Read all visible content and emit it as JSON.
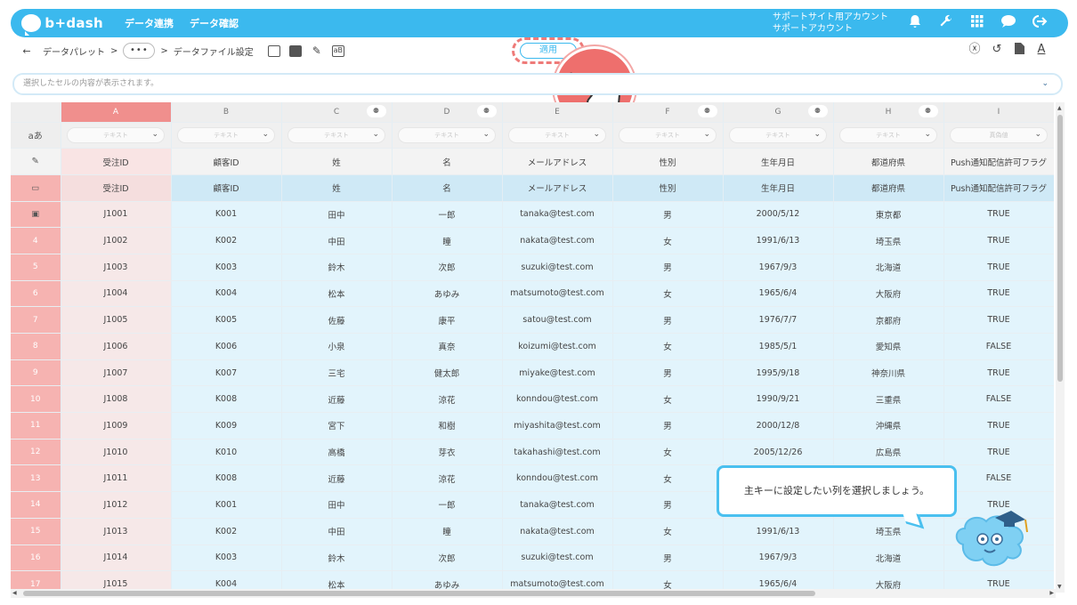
{
  "header": {
    "logo": "b+dash",
    "nav": [
      "データ連携",
      "データ確認"
    ],
    "account_line1": "サポートサイト用アカウント",
    "account_line2": "サポートアカウント",
    "icons": [
      "bell-icon",
      "wrench-icon",
      "grid-icon",
      "chat-icon",
      "logout-icon"
    ]
  },
  "toolbar": {
    "back": "←",
    "crumb1": "データパレット",
    "sep": ">",
    "ellipsis": "•••",
    "crumb2": "データファイル設定",
    "apply": "適用",
    "right_icons": [
      "clear-icon",
      "history-icon",
      "file-icon",
      "text-format-icon"
    ]
  },
  "cellbar": {
    "placeholder": "選択したセルの内容が表示されます。"
  },
  "grid": {
    "columns": [
      "A",
      "B",
      "C",
      "D",
      "E",
      "F",
      "G",
      "H",
      "I"
    ],
    "type_label": "aあ",
    "type_values": [
      "テキスト",
      "テキスト",
      "テキスト",
      "テキスト",
      "テキスト",
      "テキスト",
      "テキスト",
      "テキスト",
      "真偽値"
    ],
    "names": [
      "受注ID",
      "顧客ID",
      "姓",
      "名",
      "メールアドレス",
      "性別",
      "生年月日",
      "都道府県",
      "Push通知配信許可フラグ"
    ],
    "header_row": [
      "受注ID",
      "顧客ID",
      "姓",
      "名",
      "メールアドレス",
      "性別",
      "生年月日",
      "都道府県",
      "Push通知配信許可フラグ"
    ],
    "rows": [
      {
        "n": "",
        "cells": [
          "J1001",
          "K001",
          "田中",
          "一郎",
          "tanaka@test.com",
          "男",
          "2000/5/12",
          "東京都",
          "TRUE"
        ]
      },
      {
        "n": "4",
        "cells": [
          "J1002",
          "K002",
          "中田",
          "瞳",
          "nakata@test.com",
          "女",
          "1991/6/13",
          "埼玉県",
          "TRUE"
        ]
      },
      {
        "n": "5",
        "cells": [
          "J1003",
          "K003",
          "鈴木",
          "次郎",
          "suzuki@test.com",
          "男",
          "1967/9/3",
          "北海道",
          "TRUE"
        ]
      },
      {
        "n": "6",
        "cells": [
          "J1004",
          "K004",
          "松本",
          "あゆみ",
          "matsumoto@test.com",
          "女",
          "1965/6/4",
          "大阪府",
          "TRUE"
        ]
      },
      {
        "n": "7",
        "cells": [
          "J1005",
          "K005",
          "佐藤",
          "康平",
          "satou@test.com",
          "男",
          "1976/7/7",
          "京都府",
          "TRUE"
        ]
      },
      {
        "n": "8",
        "cells": [
          "J1006",
          "K006",
          "小泉",
          "真奈",
          "koizumi@test.com",
          "女",
          "1985/5/1",
          "愛知県",
          "FALSE"
        ]
      },
      {
        "n": "9",
        "cells": [
          "J1007",
          "K007",
          "三宅",
          "健太郎",
          "miyake@test.com",
          "男",
          "1995/9/18",
          "神奈川県",
          "TRUE"
        ]
      },
      {
        "n": "10",
        "cells": [
          "J1008",
          "K008",
          "近藤",
          "涼花",
          "konndou@test.com",
          "女",
          "1990/9/21",
          "三重県",
          "FALSE"
        ]
      },
      {
        "n": "11",
        "cells": [
          "J1009",
          "K009",
          "宮下",
          "和樹",
          "miyashita@test.com",
          "男",
          "2000/12/8",
          "沖縄県",
          "TRUE"
        ]
      },
      {
        "n": "12",
        "cells": [
          "J1010",
          "K010",
          "高橋",
          "芽衣",
          "takahashi@test.com",
          "女",
          "2005/12/26",
          "広島県",
          "TRUE"
        ]
      },
      {
        "n": "13",
        "cells": [
          "J1011",
          "K008",
          "近藤",
          "涼花",
          "konndou@test.com",
          "女",
          "",
          "",
          "FALSE"
        ]
      },
      {
        "n": "14",
        "cells": [
          "J1012",
          "K001",
          "田中",
          "一郎",
          "tanaka@test.com",
          "男",
          "",
          "",
          "TRUE"
        ]
      },
      {
        "n": "15",
        "cells": [
          "J1013",
          "K002",
          "中田",
          "瞳",
          "nakata@test.com",
          "女",
          "1991/6/13",
          "埼玉県",
          ""
        ]
      },
      {
        "n": "16",
        "cells": [
          "J1014",
          "K003",
          "鈴木",
          "次郎",
          "suzuki@test.com",
          "男",
          "1967/9/3",
          "北海道",
          ""
        ]
      },
      {
        "n": "17",
        "cells": [
          "J1015",
          "K004",
          "松本",
          "あゆみ",
          "matsumoto@test.com",
          "女",
          "1965/6/4",
          "大阪府",
          "TRUE"
        ]
      }
    ]
  },
  "tooltip": {
    "text": "主キーに設定したい列を選択しましょう。"
  },
  "colors": {
    "brand": "#3bb9ee",
    "selected_column": "#f08f8d",
    "row_number": "#f6b3b1",
    "data_cell": "#e2f4fc"
  }
}
